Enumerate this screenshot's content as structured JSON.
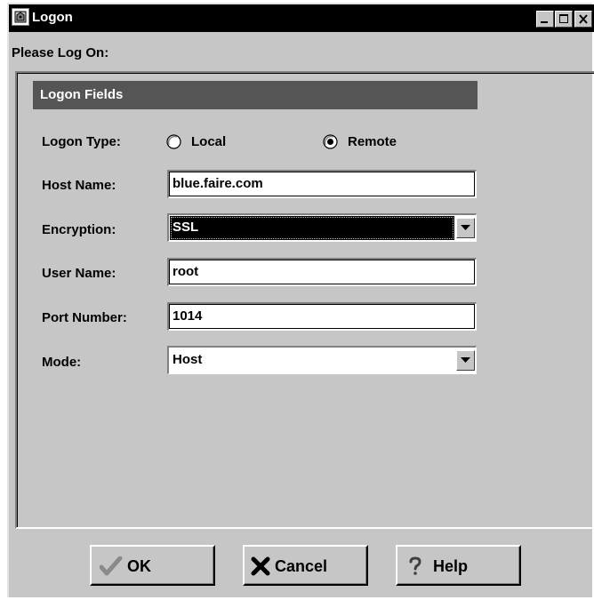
{
  "window": {
    "title": "Logon"
  },
  "prompt": "Please Log On:",
  "section": {
    "title": "Logon Fields"
  },
  "fields": {
    "logon_type": {
      "label": "Logon Type:",
      "options": [
        "Local",
        "Remote"
      ],
      "selected": "Remote"
    },
    "host_name": {
      "label": "Host Name:",
      "value": "blue.faire.com"
    },
    "encryption": {
      "label": "Encryption:",
      "value": "SSL"
    },
    "user_name": {
      "label": "User Name:",
      "value": "root"
    },
    "port_number": {
      "label": "Port Number:",
      "value": "1014"
    },
    "mode": {
      "label": "Mode:",
      "value": "Host"
    }
  },
  "buttons": {
    "ok": "OK",
    "cancel": "Cancel",
    "help": "Help"
  },
  "icons": {
    "app": "app-icon",
    "minimize": "minimize-icon",
    "maximize": "maximize-icon",
    "close": "close-icon",
    "ok": "checkmark-icon",
    "cancel": "x-mark-icon",
    "help": "question-mark-icon"
  }
}
